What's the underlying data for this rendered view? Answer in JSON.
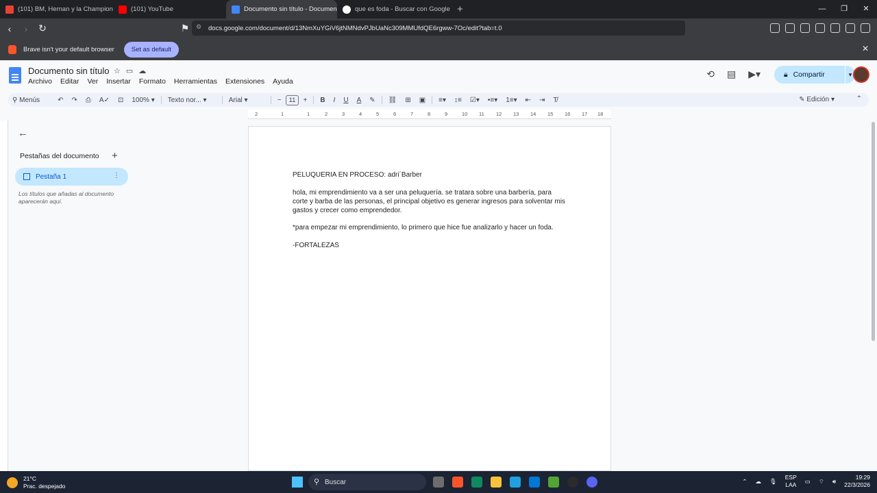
{
  "browser": {
    "tabs": [
      {
        "label": "(101) BM, Hernan y la Champion",
        "fav_color": "#e94235"
      },
      {
        "label": "(101) YouTube",
        "fav_color": "#ff0000"
      },
      {
        "label": "Documento sin título - Documen",
        "fav_color": "#4285f4"
      },
      {
        "label": "que es foda - Buscar con Google",
        "fav_color": "#ffffff"
      }
    ],
    "url": "docs.google.com/document/d/13NmXuYGiV6jtNMNdvPJbUaNc309MMUfdQE6rgww-7Oc/edit?tab=t.0",
    "infobar_text": "Brave isn't your default browser",
    "set_default_label": "Set as default"
  },
  "docs": {
    "title": "Documento sin título",
    "menus": [
      "Archivo",
      "Editar",
      "Ver",
      "Insertar",
      "Formato",
      "Herramientas",
      "Extensiones",
      "Ayuda"
    ],
    "share_label": "Compartir",
    "toolbar": {
      "menus_label": "Menús",
      "zoom": "100%",
      "style": "Texto nor...",
      "font": "Arial",
      "font_size": "11",
      "mode": "Edición"
    },
    "ruler_labels": [
      "2",
      "1",
      "1",
      "2",
      "3",
      "4",
      "5",
      "6",
      "7",
      "8",
      "9",
      "10",
      "11",
      "12",
      "13",
      "14",
      "15",
      "16",
      "17",
      "18"
    ],
    "sidebar": {
      "heading": "Pestañas del documento",
      "tab_label": "Pestaña 1",
      "hint": "Los títulos que añadas al documento aparecerán aquí."
    },
    "body": {
      "line1": " PELUQUERIA EN PROCESO: adri´Barber",
      "para1": "hola, mi emprendimiento va a ser una peluquería. se tratara sobre una barbería, para corte y barba de las personas, el principal objetivo es generar ingresos para solventar mis gastos y crecer como emprendedor.",
      "para2": "*para empezar mi emprendimiento, lo primero que hice fue analizarlo y hacer un foda.",
      "para3": "-FORTALEZAS"
    }
  },
  "taskbar": {
    "temp": "21°C",
    "weather": "Prac. despejado",
    "search_label": "Buscar",
    "lang1": "ESP",
    "lang2": "LAA",
    "time": "19:29",
    "date": "22/3/2026"
  }
}
